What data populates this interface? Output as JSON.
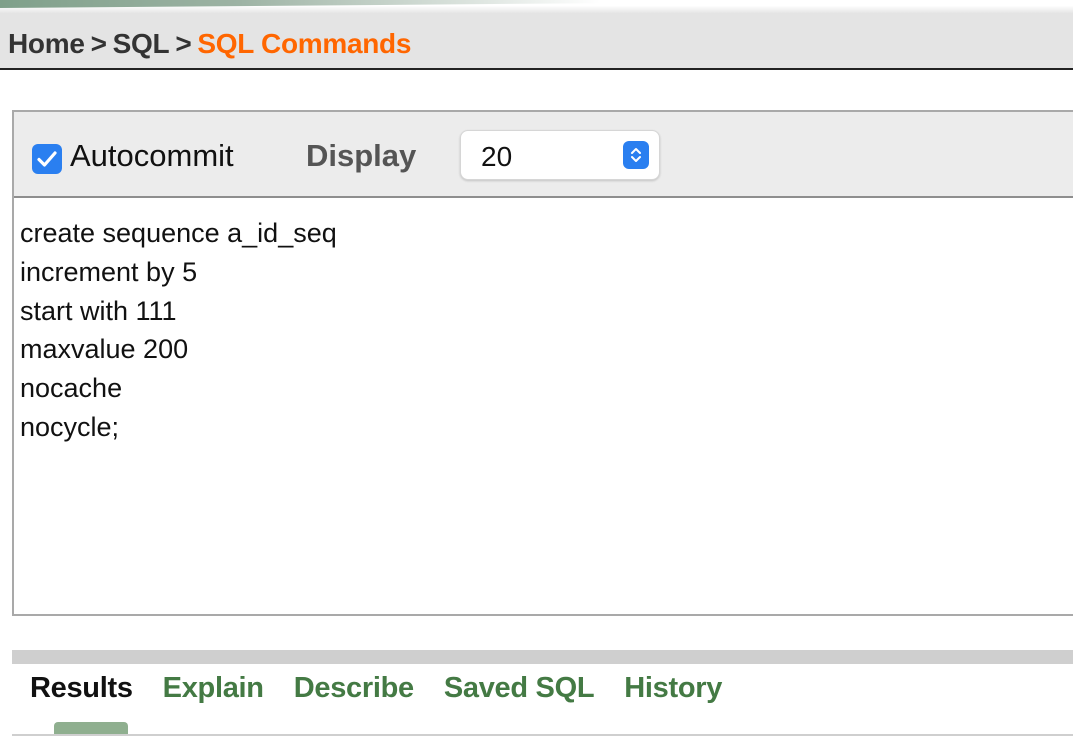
{
  "breadcrumb": {
    "items": [
      "Home",
      "SQL",
      "SQL Commands"
    ],
    "separator": ">"
  },
  "toolbar": {
    "autocommit_label": "Autocommit",
    "autocommit_checked": true,
    "display_label": "Display",
    "display_value": "20"
  },
  "editor": {
    "lines": [
      "create sequence a_id_seq",
      "increment by 5",
      "start with 111",
      "maxvalue 200",
      "nocache",
      "nocycle;"
    ]
  },
  "tabs": {
    "items": [
      "Results",
      "Explain",
      "Describe",
      "Saved SQL",
      "History"
    ],
    "active": "Results"
  },
  "colors": {
    "breadcrumb_current": "#ff6600",
    "tab_link": "#447a44",
    "checkbox": "#2a7ff0"
  }
}
